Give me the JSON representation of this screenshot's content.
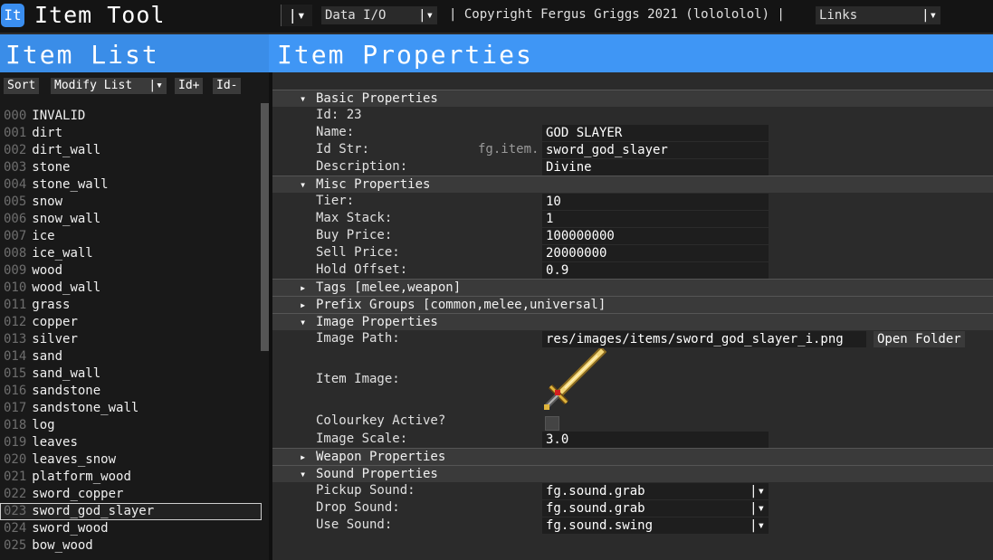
{
  "app": {
    "icon_text": "It",
    "title": "Item Tool",
    "title_dropdown_arrow": "|▾",
    "data_menu": "Data I/O",
    "data_menu_arrow": "|▾",
    "copyright": "| Copyright Fergus Griggs 2021 (lolololol) |",
    "links_menu": "Links",
    "links_menu_arrow": "|▾"
  },
  "headers": {
    "item_list": "Item List",
    "item_properties": "Item Properties"
  },
  "toolbar": {
    "sort": "Sort",
    "modify_list": "Modify List",
    "modify_list_arrow": "|▾",
    "id_plus": "Id+",
    "id_minus": "Id-"
  },
  "items": [
    {
      "id": "000",
      "name": "INVALID"
    },
    {
      "id": "001",
      "name": "dirt"
    },
    {
      "id": "002",
      "name": "dirt_wall"
    },
    {
      "id": "003",
      "name": "stone"
    },
    {
      "id": "004",
      "name": "stone_wall"
    },
    {
      "id": "005",
      "name": "snow"
    },
    {
      "id": "006",
      "name": "snow_wall"
    },
    {
      "id": "007",
      "name": "ice"
    },
    {
      "id": "008",
      "name": "ice_wall"
    },
    {
      "id": "009",
      "name": "wood"
    },
    {
      "id": "010",
      "name": "wood_wall"
    },
    {
      "id": "011",
      "name": "grass"
    },
    {
      "id": "012",
      "name": "copper"
    },
    {
      "id": "013",
      "name": "silver"
    },
    {
      "id": "014",
      "name": "sand"
    },
    {
      "id": "015",
      "name": "sand_wall"
    },
    {
      "id": "016",
      "name": "sandstone"
    },
    {
      "id": "017",
      "name": "sandstone_wall"
    },
    {
      "id": "018",
      "name": "log"
    },
    {
      "id": "019",
      "name": "leaves"
    },
    {
      "id": "020",
      "name": "leaves_snow"
    },
    {
      "id": "021",
      "name": "platform_wood"
    },
    {
      "id": "022",
      "name": "sword_copper"
    },
    {
      "id": "023",
      "name": "sword_god_slayer",
      "selected": true
    },
    {
      "id": "024",
      "name": "sword_wood"
    },
    {
      "id": "025",
      "name": "bow_wood"
    }
  ],
  "sections": {
    "basic": "Basic Properties",
    "misc": "Misc Properties",
    "tags": "Tags [melee,weapon]",
    "prefix": "Prefix Groups [common,melee,universal]",
    "image": "Image Properties",
    "weapon": "Weapon Properties",
    "sound": "Sound Properties",
    "chev_open": "▾",
    "chev_closed": "▸"
  },
  "basic": {
    "id_label": "Id: 23",
    "name_label": "Name:",
    "name_value": "GOD SLAYER",
    "idstr_label": "Id Str:",
    "idstr_prefix": "fg.item.",
    "idstr_value": "sword_god_slayer",
    "desc_label": "Description:",
    "desc_value": "Divine"
  },
  "misc": {
    "tier_label": "Tier:",
    "tier_value": "10",
    "maxstack_label": "Max Stack:",
    "maxstack_value": "1",
    "buy_label": "Buy Price:",
    "buy_value": "100000000",
    "sell_label": "Sell Price:",
    "sell_value": "20000000",
    "hold_label": "Hold Offset:",
    "hold_value": "0.9"
  },
  "image": {
    "path_label": "Image Path:",
    "path_value": "res/images/items/sword_god_slayer_i.png",
    "open_folder": "Open Folder",
    "item_image_label": "Item Image:",
    "colourkey_label": "Colourkey Active?",
    "scale_label": "Image Scale:",
    "scale_value": "3.0"
  },
  "sound": {
    "pickup_label": "Pickup Sound:",
    "pickup_value": "fg.sound.grab",
    "drop_label": "Drop Sound:",
    "drop_value": "fg.sound.grab",
    "use_label": "Use Sound:",
    "use_value": "fg.sound.swing",
    "arrow": "|▾"
  },
  "colors": {
    "accent": "#3f96f5",
    "panel": "#2b2b2b",
    "list_bg": "#191919"
  }
}
